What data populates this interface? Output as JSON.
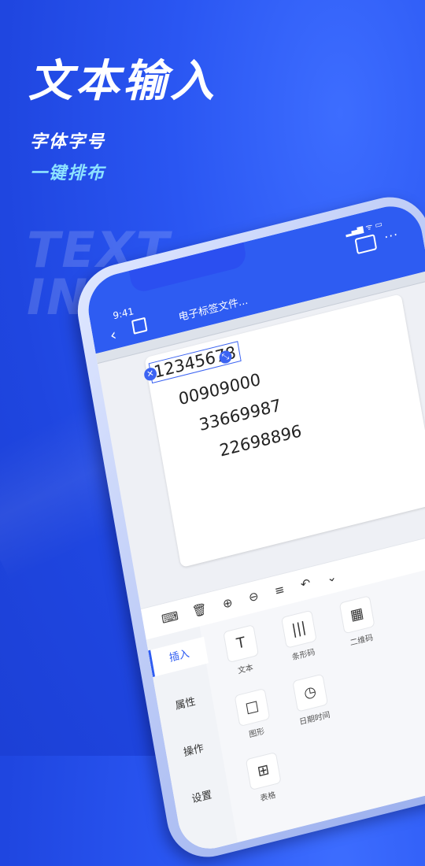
{
  "headline": "文本输入",
  "subtitle1": "字体字号",
  "subtitle2": "一键排布",
  "bg_text_line1": "TEXT",
  "bg_text_line2": "IN",
  "phone": {
    "status_time": "9:41",
    "title": "电子标签文件...",
    "label_numbers": [
      "12345678",
      "00909000",
      "33669987",
      "22698896"
    ],
    "side_tabs": [
      "插入",
      "属性",
      "操作",
      "设置"
    ],
    "tiles": [
      {
        "icon": "text-icon",
        "glyph": "T",
        "label": "文本"
      },
      {
        "icon": "barcode-icon",
        "glyph": "|||",
        "label": "条形码"
      },
      {
        "icon": "qrcode-icon",
        "glyph": "▦",
        "label": "二维码"
      },
      {
        "icon": "shape-icon",
        "glyph": "□",
        "label": "图形"
      },
      {
        "icon": "datetime-icon",
        "glyph": "◷",
        "label": "日期时间"
      },
      {
        "icon": "table-icon",
        "glyph": "⊞",
        "label": "表格"
      }
    ]
  },
  "colors": {
    "accent": "#2e5cf2",
    "highlight": "#8ee3ff"
  }
}
